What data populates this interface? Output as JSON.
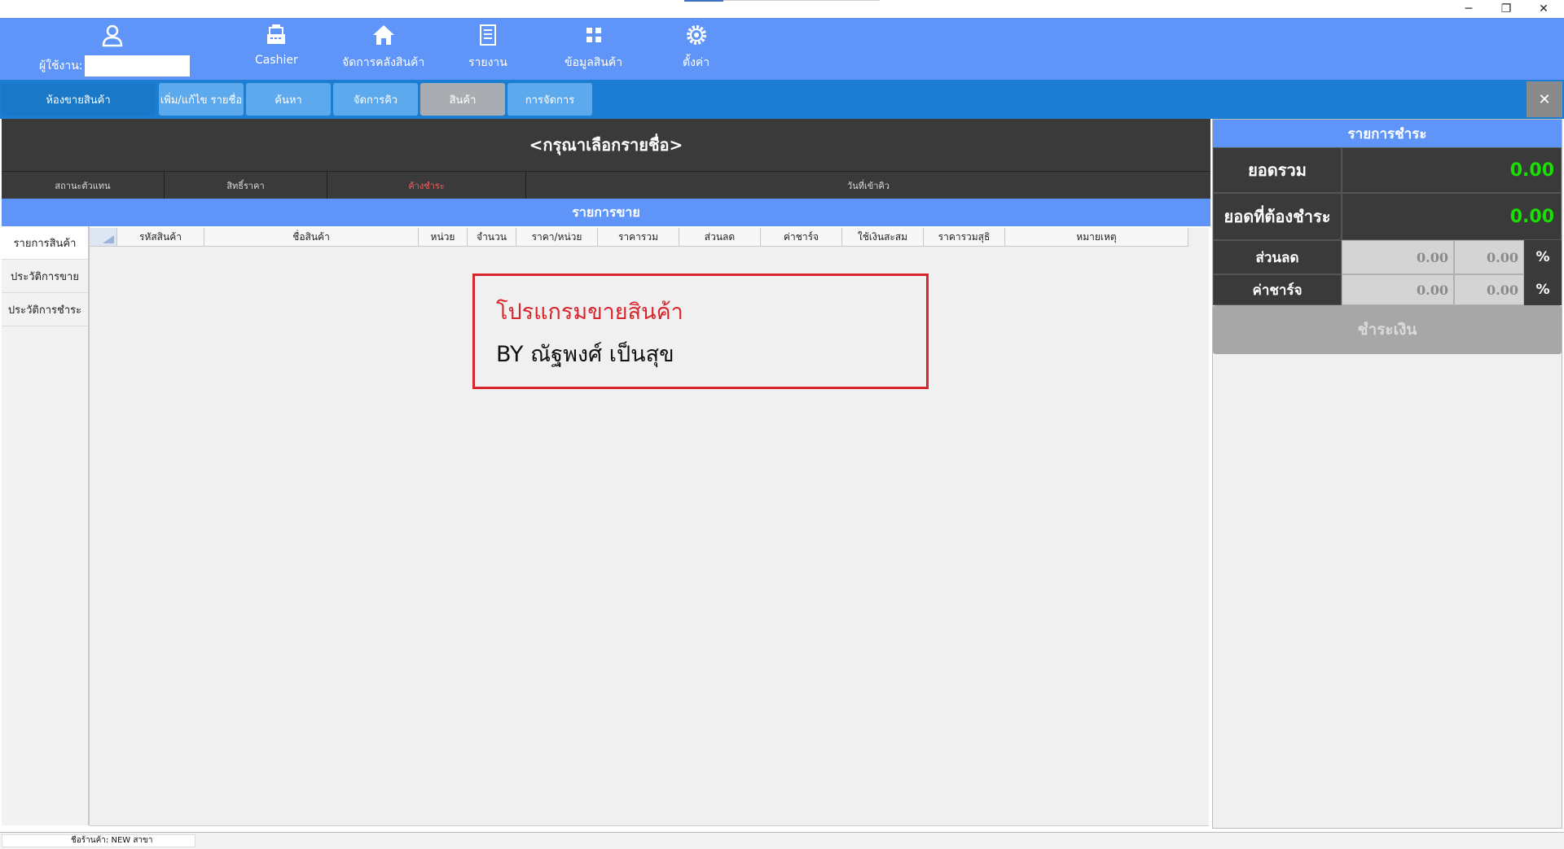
{
  "window": {
    "minimize_glyph": "─",
    "restore_glyph": "❐",
    "close_glyph": "✕"
  },
  "toolbar": {
    "user_label": "ผู้ใช้งาน:",
    "user_value": "",
    "items": [
      {
        "label": "Cashier",
        "icon": "cash-register-icon"
      },
      {
        "label": "จัดการคลังสินค้า",
        "icon": "home-icon"
      },
      {
        "label": "รายงาน",
        "icon": "document-icon"
      },
      {
        "label": "ข้อมูลสินค้า",
        "icon": "grid-icon"
      },
      {
        "label": "ตั้งค่า",
        "icon": "gear-icon"
      }
    ]
  },
  "tabs": {
    "home": "ห้องขายสินค้า",
    "items": [
      "เพิ่ม/แก้ไข รายชื่อ",
      "ค้นหา",
      "จัดการคิว",
      "สินค้า",
      "การจัดการ"
    ],
    "close_glyph": "✕"
  },
  "customer": {
    "title": "<กรุณาเลือกรายชื่อ>",
    "fields": [
      "สถานะตัวแทน",
      "สิทธิ์ราคา",
      "ค้างชำระ",
      "วันที่เข้าคิว"
    ]
  },
  "sales": {
    "header": "รายการขาย",
    "side_tabs": [
      "รายการสินค้า",
      "ประวัติการขาย",
      "ประวัติการชำระ"
    ],
    "columns": [
      "รหัสสินค้า",
      "ชื่อสินค้า",
      "หน่วย",
      "จำนวน",
      "ราคา/หน่วย",
      "ราคารวม",
      "ส่วนลด",
      "ค่าชาร์จ",
      "ใช้เงินสะสม",
      "ราคารวมสุธิ",
      "หมายเหตุ"
    ]
  },
  "credit": {
    "line1": "โปรแกรมขายสินค้า",
    "line2": "BY ณัฐพงศ์ เป็นสุข"
  },
  "payment": {
    "header": "รายการชำระ",
    "total_label": "ยอดรวม",
    "total_value": "0.00",
    "due_label": "ยอดที่ต้องชำระ",
    "due_value": "0.00",
    "discount_label": "ส่วนลด",
    "discount_amount": "0.00",
    "discount_percent": "0.00",
    "charge_label": "ค่าชาร์จ",
    "charge_amount": "0.00",
    "charge_percent": "0.00",
    "percent_sign": "%",
    "pay_button": "ชำระเงิน"
  },
  "status": {
    "shop": "ชื่อร้านค้า: NEW สาขา"
  },
  "colors": {
    "toolbar_blue": "#5f94f8",
    "tab_bar_blue": "#1b7ed2",
    "dark_panel": "#3a3a3a",
    "amount_green": "#18e000",
    "credit_red": "#d9262c"
  }
}
